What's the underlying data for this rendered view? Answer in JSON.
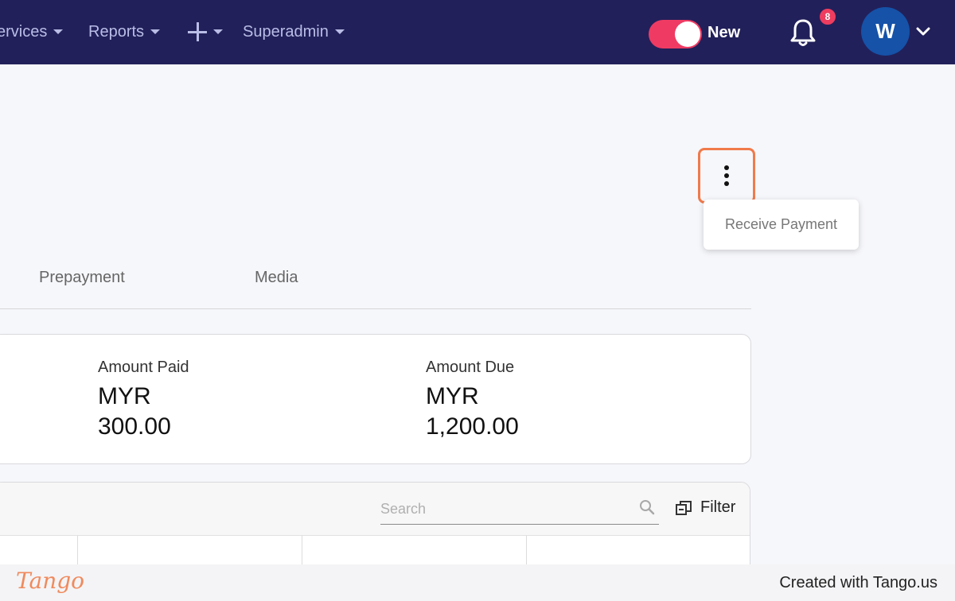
{
  "nav": {
    "items": [
      {
        "label": "ervices"
      },
      {
        "label": "Reports"
      },
      {
        "label": ""
      },
      {
        "label": "Superadmin"
      }
    ],
    "toggle_label": "New",
    "notification_count": "8",
    "avatar_initial": "W"
  },
  "actions_menu": {
    "items": [
      {
        "label": "Receive Payment"
      }
    ]
  },
  "tabs": [
    {
      "label": "Prepayment"
    },
    {
      "label": "Media"
    }
  ],
  "summary": {
    "amount_paid": {
      "label": "Amount Paid",
      "currency": "MYR",
      "value": "300.00"
    },
    "amount_due": {
      "label": "Amount Due",
      "currency": "MYR",
      "value": "1,200.00"
    }
  },
  "table": {
    "search_placeholder": "Search",
    "filter_label": "Filter"
  },
  "footer": {
    "logo": "Tango",
    "text": "Created with Tango.us"
  },
  "colors": {
    "nav_bg": "#22205a",
    "toggle_on": "#ef3b63",
    "badge": "#ee3d5f",
    "avatar": "#1552a8",
    "highlight": "#f07a4a",
    "tango": "#f08a5d"
  }
}
